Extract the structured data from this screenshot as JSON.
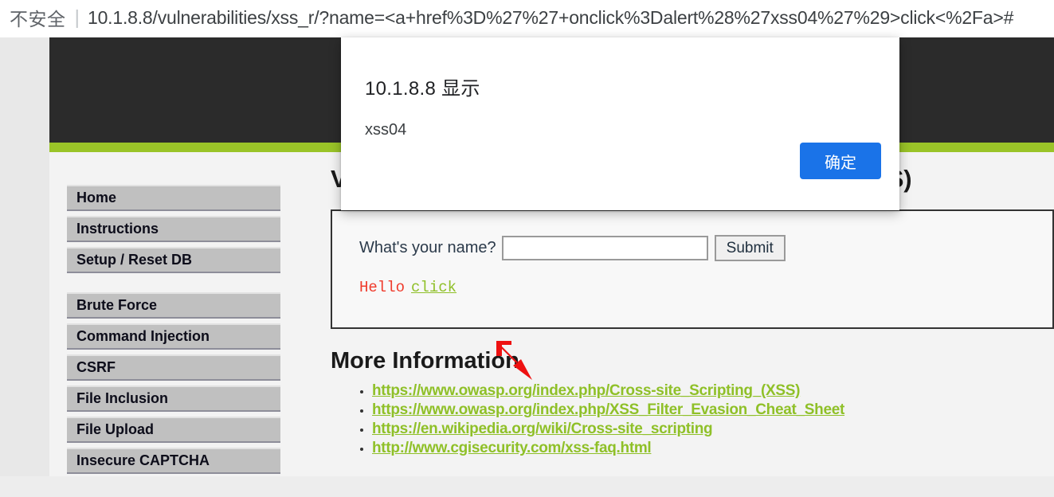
{
  "browser": {
    "security_label": "不安全",
    "divider": "|",
    "url": "10.1.8.8/vulnerabilities/xss_r/?name=<a+href%3D%27%27+onclick%3Dalert%28%27xss04%27%29>click<%2Fa>#"
  },
  "theme": {
    "header_bg": "#2b2b2b",
    "accent_green": "#9ac428",
    "link_green": "#8fc028",
    "dialog_blue": "#1a73e8",
    "nav_gray": "#c0c0c0",
    "error_red": "#ef3b2c"
  },
  "sidebar": {
    "groups": [
      {
        "items": [
          {
            "label": "Home"
          },
          {
            "label": "Instructions"
          },
          {
            "label": "Setup / Reset DB"
          }
        ]
      },
      {
        "items": [
          {
            "label": "Brute Force"
          },
          {
            "label": "Command Injection"
          },
          {
            "label": "CSRF"
          },
          {
            "label": "File Inclusion"
          },
          {
            "label": "File Upload"
          },
          {
            "label": "Insecure CAPTCHA"
          }
        ]
      }
    ]
  },
  "main": {
    "page_title": "Vulnerability: Reflected Cross Site Scripting (XSS)",
    "form": {
      "label": "What's your name?",
      "input_value": "",
      "input_placeholder": "",
      "submit_label": "Submit"
    },
    "output": {
      "greeting": "Hello",
      "injected_link_text": "click"
    },
    "more_information": {
      "heading": "More Information",
      "links": [
        "https://www.owasp.org/index.php/Cross-site_Scripting_(XSS)",
        "https://www.owasp.org/index.php/XSS_Filter_Evasion_Cheat_Sheet",
        "https://en.wikipedia.org/wiki/Cross-site_scripting",
        "http://www.cgisecurity.com/xss-faq.html"
      ]
    }
  },
  "dialog": {
    "title": "10.1.8.8 显示",
    "message": "xss04",
    "ok_label": "确定"
  }
}
